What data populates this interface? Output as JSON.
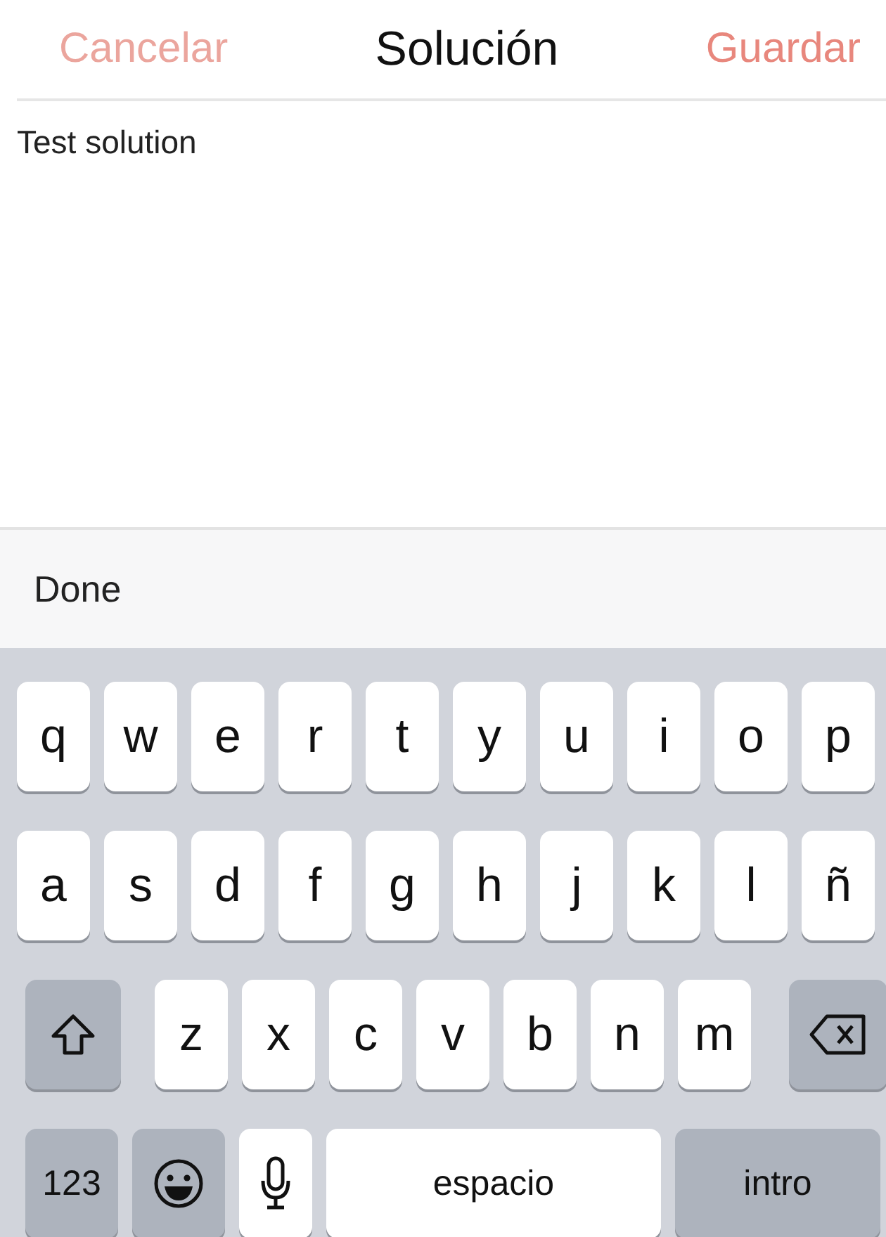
{
  "nav": {
    "cancel": "Cancelar",
    "title": "Solución",
    "save": "Guardar"
  },
  "editor": {
    "value": "Test solution"
  },
  "toolbar": {
    "done": "Done"
  },
  "keyboard": {
    "rows": [
      {
        "keys": [
          {
            "kind": "letter",
            "label": "q"
          },
          {
            "kind": "letter",
            "label": "w"
          },
          {
            "kind": "letter",
            "label": "e"
          },
          {
            "kind": "letter",
            "label": "r"
          },
          {
            "kind": "letter",
            "label": "t"
          },
          {
            "kind": "letter",
            "label": "y"
          },
          {
            "kind": "letter",
            "label": "u"
          },
          {
            "kind": "letter",
            "label": "i"
          },
          {
            "kind": "letter",
            "label": "o"
          },
          {
            "kind": "letter",
            "label": "p"
          }
        ]
      },
      {
        "keys": [
          {
            "kind": "letter",
            "label": "a"
          },
          {
            "kind": "letter",
            "label": "s"
          },
          {
            "kind": "letter",
            "label": "d"
          },
          {
            "kind": "letter",
            "label": "f"
          },
          {
            "kind": "letter",
            "label": "g"
          },
          {
            "kind": "letter",
            "label": "h"
          },
          {
            "kind": "letter",
            "label": "j"
          },
          {
            "kind": "letter",
            "label": "k"
          },
          {
            "kind": "letter",
            "label": "l"
          },
          {
            "kind": "letter",
            "label": "ñ"
          }
        ]
      },
      {
        "keys": [
          {
            "kind": "shift"
          },
          {
            "kind": "letter",
            "label": "z"
          },
          {
            "kind": "letter",
            "label": "x"
          },
          {
            "kind": "letter",
            "label": "c"
          },
          {
            "kind": "letter",
            "label": "v"
          },
          {
            "kind": "letter",
            "label": "b"
          },
          {
            "kind": "letter",
            "label": "n"
          },
          {
            "kind": "letter",
            "label": "m"
          },
          {
            "kind": "delete"
          }
        ]
      },
      {
        "keys": [
          {
            "kind": "numbers",
            "label": "123"
          },
          {
            "kind": "emoji"
          },
          {
            "kind": "mic"
          },
          {
            "kind": "space",
            "label": "espacio"
          },
          {
            "kind": "return",
            "label": "intro"
          }
        ]
      }
    ]
  }
}
